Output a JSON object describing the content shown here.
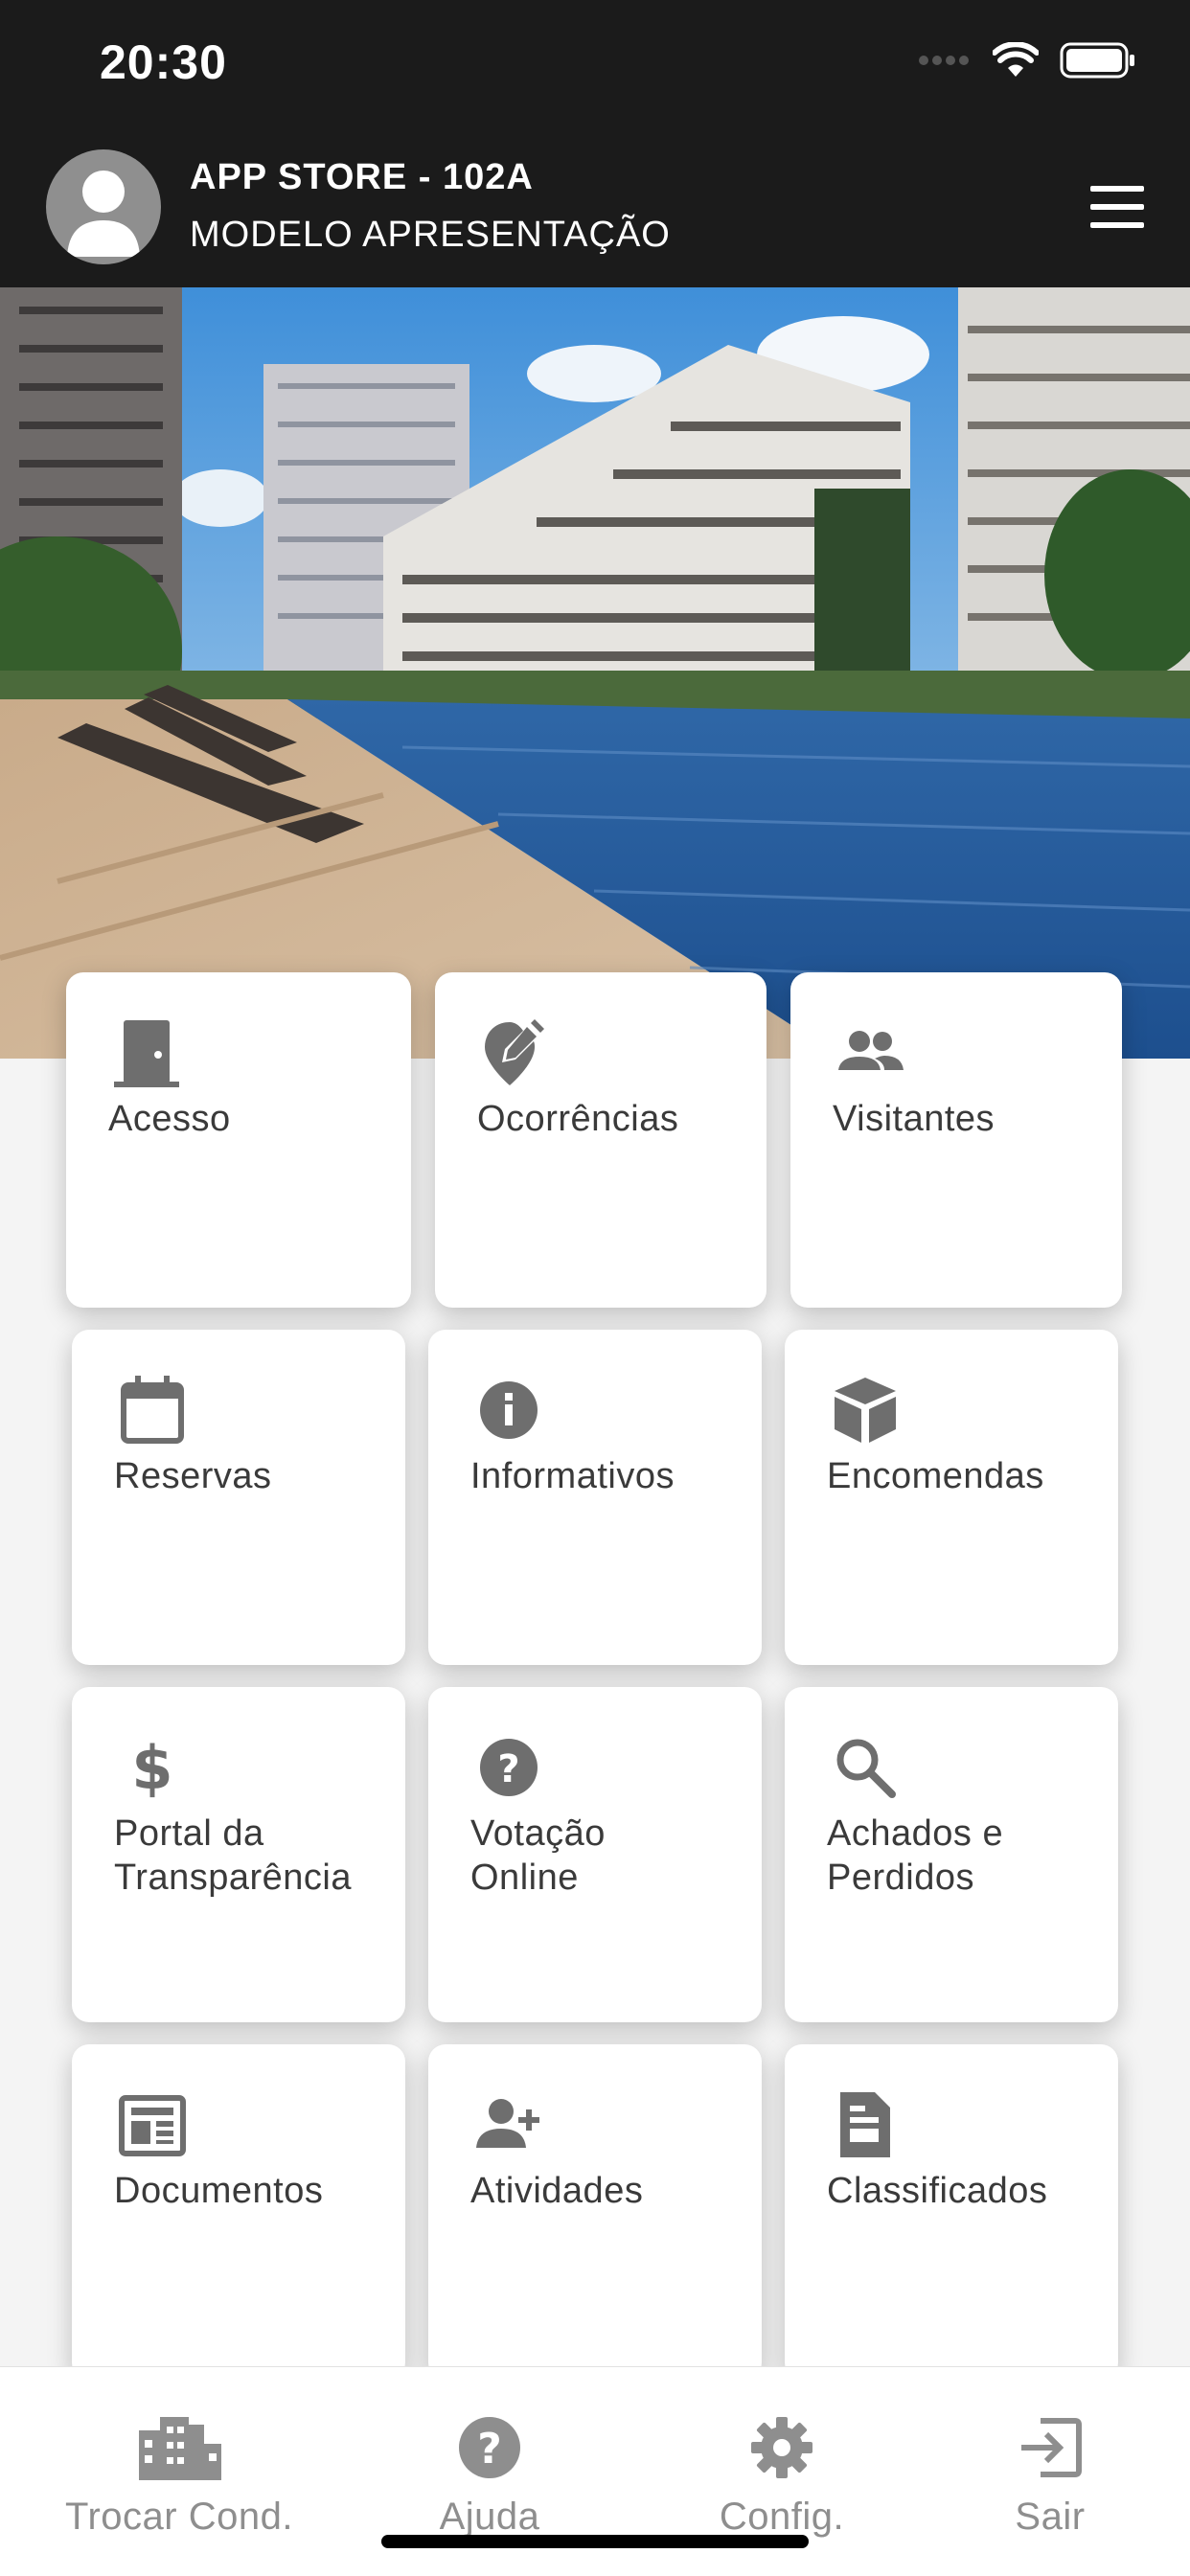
{
  "status_bar": {
    "time": "20:30"
  },
  "header": {
    "title": "APP STORE - 102A",
    "subtitle": "MODELO APRESENTAÇÃO"
  },
  "tiles": [
    {
      "label": "Acesso",
      "icon": "door-icon"
    },
    {
      "label": "Ocorrências",
      "icon": "edit-location-icon"
    },
    {
      "label": "Visitantes",
      "icon": "people-icon"
    },
    {
      "label": "Reservas",
      "icon": "calendar-icon"
    },
    {
      "label": "Informativos",
      "icon": "info-icon"
    },
    {
      "label": "Encomendas",
      "icon": "package-icon"
    },
    {
      "label": "Portal da\nTransparência",
      "icon": "dollar-icon"
    },
    {
      "label": "Votação\nOnline",
      "icon": "help-icon"
    },
    {
      "label": "Achados e\nPerdidos",
      "icon": "search-icon"
    },
    {
      "label": "Documentos",
      "icon": "newspaper-icon"
    },
    {
      "label": "Atividades",
      "icon": "person-add-icon"
    },
    {
      "label": "Classificados",
      "icon": "receipt-icon"
    }
  ],
  "bottom_nav": [
    {
      "label": "Trocar Cond.",
      "icon": "city-icon"
    },
    {
      "label": "Ajuda",
      "icon": "help-icon"
    },
    {
      "label": "Config.",
      "icon": "gear-icon"
    },
    {
      "label": "Sair",
      "icon": "exit-icon"
    }
  ],
  "colors": {
    "header_bg": "#1b1b1b",
    "icon_gray": "#6e6e6e",
    "text_gray": "#3a3a3a",
    "nav_gray": "#8e8e8e"
  }
}
